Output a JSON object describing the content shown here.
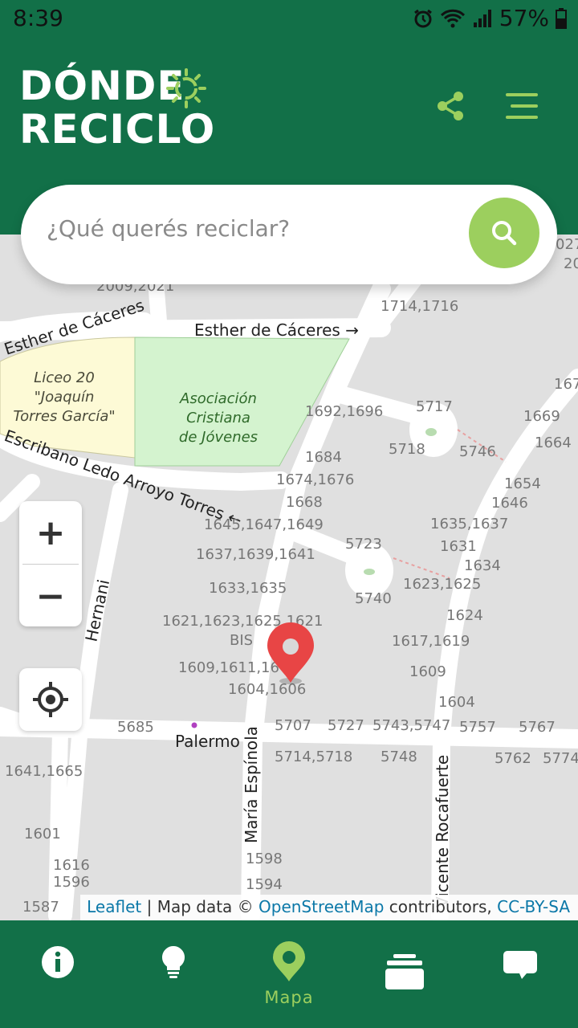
{
  "status_bar": {
    "time": "8:39",
    "battery": "57%"
  },
  "header": {
    "logo_line1": "DÓNDE",
    "logo_line2": "RECICLO"
  },
  "search": {
    "placeholder": "¿Qué querés reciclar?"
  },
  "map": {
    "zoom_in": "+",
    "zoom_out": "−",
    "streets": [
      "Esther de Cáceres",
      "Esther de Cáceres →",
      "Escribano Ledo Arroyo Torres ←",
      "Hernani",
      "Palermo",
      "María Espínola",
      "Vicente Rocafuerte"
    ],
    "places": [
      {
        "name_lines": [
          "Liceo 20",
          "\"Joaquín",
          "Torres García\""
        ]
      },
      {
        "name_lines": [
          "Asociación",
          "Cristiana",
          "de Jóvenes"
        ]
      }
    ],
    "address_numbers": [
      "2009,2021",
      "1714,1716",
      "1692,1696",
      "5717",
      "5718",
      "5746",
      "1684",
      "1674,1676",
      "1668",
      "1645,1647,1649",
      "1637,1639,1641",
      "1633,1635",
      "1621,1623,1625,1621",
      "BIS",
      "1609,1611,16",
      "1604,1606",
      "5723",
      "5740",
      "1635,1637",
      "1631",
      "1634",
      "1623,1625",
      "1624",
      "1617,1619",
      "1609",
      "1604",
      "1654",
      "1646",
      "1669",
      "1664",
      "167",
      "5685",
      "5707",
      "5727",
      "5743,5747",
      "5757",
      "5767",
      "5714,5718",
      "5748",
      "5762",
      "5774",
      "1641,1665",
      "1601",
      "1616",
      "1596",
      "1598",
      "1594",
      "1587",
      "027",
      "20"
    ]
  },
  "attribution": {
    "leaflet": "Leaflet",
    "text1": " | Map data © ",
    "osm": "OpenStreetMap",
    "text2": " contributors, ",
    "license": "CC-BY-SA"
  },
  "bottom_nav": {
    "active_label": "Mapa"
  },
  "colors": {
    "primary": "#127048",
    "accent": "#9ccf5e",
    "marker": "#e84545"
  }
}
